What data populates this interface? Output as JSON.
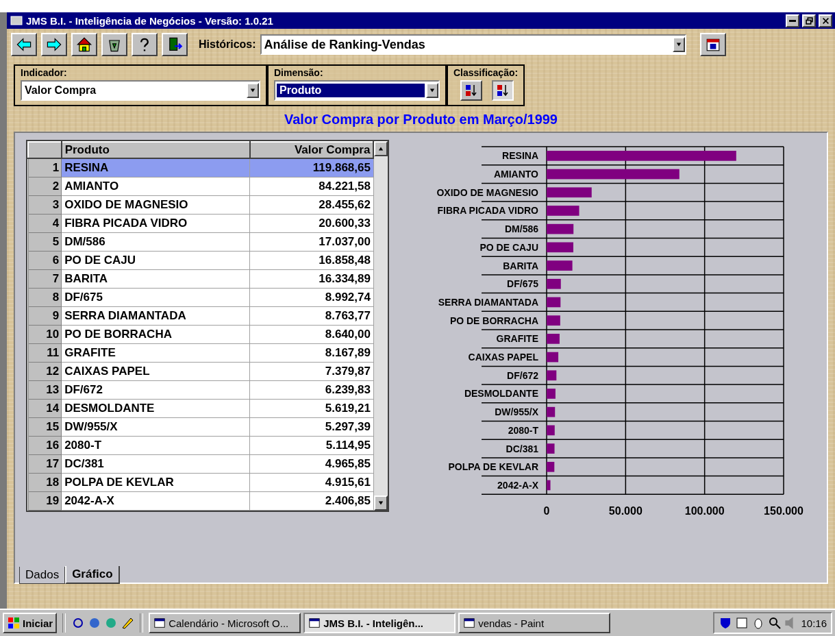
{
  "window": {
    "title": "JMS B.I. - Inteligência de Negócios - Versão: 1.0.21"
  },
  "toolbar": {
    "history_label": "Históricos:",
    "history_value": "Análise de Ranking-Vendas"
  },
  "filters": {
    "indicator_label": "Indicador:",
    "indicator_value": "Valor Compra",
    "dimension_label": "Dimensão:",
    "dimension_value": "Produto",
    "sort_label": "Classificação:",
    "sort_buttons": [
      {
        "kind": "ascending",
        "selected": false
      },
      {
        "kind": "descending",
        "selected": true
      }
    ]
  },
  "heading": "Valor Compra por Produto em Março/1999",
  "table": {
    "columns": [
      "Produto",
      "Valor Compra"
    ],
    "rows": [
      {
        "n": "1",
        "name": "RESINA",
        "value": "119.868,65",
        "selected": true
      },
      {
        "n": "2",
        "name": "AMIANTO",
        "value": "84.221,58",
        "selected": false
      },
      {
        "n": "3",
        "name": "OXIDO DE MAGNESIO",
        "value": "28.455,62",
        "selected": false
      },
      {
        "n": "4",
        "name": "FIBRA PICADA VIDRO",
        "value": "20.600,33",
        "selected": false
      },
      {
        "n": "5",
        "name": "DM/586",
        "value": "17.037,00",
        "selected": false
      },
      {
        "n": "6",
        "name": "PO DE CAJU",
        "value": "16.858,48",
        "selected": false
      },
      {
        "n": "7",
        "name": "BARITA",
        "value": "16.334,89",
        "selected": false
      },
      {
        "n": "8",
        "name": "DF/675",
        "value": "8.992,74",
        "selected": false
      },
      {
        "n": "9",
        "name": "SERRA DIAMANTADA",
        "value": "8.763,77",
        "selected": false
      },
      {
        "n": "10",
        "name": "PO DE BORRACHA",
        "value": "8.640,00",
        "selected": false
      },
      {
        "n": "11",
        "name": "GRAFITE",
        "value": "8.167,89",
        "selected": false
      },
      {
        "n": "12",
        "name": "CAIXAS PAPEL",
        "value": "7.379,87",
        "selected": false
      },
      {
        "n": "13",
        "name": "DF/672",
        "value": "6.239,83",
        "selected": false
      },
      {
        "n": "14",
        "name": "DESMOLDANTE",
        "value": "5.619,21",
        "selected": false
      },
      {
        "n": "15",
        "name": "DW/955/X",
        "value": "5.297,39",
        "selected": false
      },
      {
        "n": "16",
        "name": "2080-T",
        "value": "5.114,95",
        "selected": false
      },
      {
        "n": "17",
        "name": "DC/381",
        "value": "4.965,85",
        "selected": false
      },
      {
        "n": "18",
        "name": "POLPA DE KEVLAR",
        "value": "4.915,61",
        "selected": false
      },
      {
        "n": "19",
        "name": "2042-A-X",
        "value": "2.406,85",
        "selected": false
      }
    ]
  },
  "chart": {
    "chart_data": {
      "type": "bar",
      "orientation": "horizontal",
      "categories": [
        "RESINA",
        "AMIANTO",
        "OXIDO DE MAGNESIO",
        "FIBRA PICADA VIDRO",
        "DM/586",
        "PO DE CAJU",
        "BARITA",
        "DF/675",
        "SERRA DIAMANTADA",
        "PO DE BORRACHA",
        "GRAFITE",
        "CAIXAS PAPEL",
        "DF/672",
        "DESMOLDANTE",
        "DW/955/X",
        "2080-T",
        "DC/381",
        "POLPA DE KEVLAR",
        "2042-A-X"
      ],
      "series": [
        {
          "color": "#800080",
          "values": [
            120000,
            84000,
            28500,
            20600,
            17000,
            16900,
            16300,
            9000,
            8800,
            8600,
            8200,
            7400,
            6200,
            5600,
            5300,
            5100,
            5000,
            4900,
            2400
          ]
        }
      ],
      "xlim": [
        0,
        150000
      ],
      "xticks": [
        {
          "value": 0,
          "label": "0"
        },
        {
          "value": 50000,
          "label": "50.000"
        },
        {
          "value": 100000,
          "label": "100.000"
        },
        {
          "value": 150000,
          "label": "150.000"
        }
      ]
    }
  },
  "view_tabs": [
    {
      "label": "Dados",
      "selected": false
    },
    {
      "label": "Gráfico",
      "selected": true
    }
  ],
  "taskbar": {
    "start": "Iniciar",
    "tasks": [
      {
        "label": "Calendário - Microsoft O...",
        "selected": false
      },
      {
        "label": "JMS B.I. - Inteligên...",
        "selected": true
      },
      {
        "label": "vendas - Paint",
        "selected": false
      }
    ],
    "clock": "10:16"
  }
}
